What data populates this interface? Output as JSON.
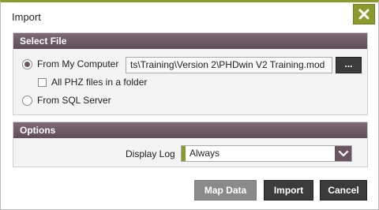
{
  "dialog": {
    "title": "Import",
    "close_icon": "close-icon"
  },
  "select_file": {
    "header": "Select File",
    "from_my_computer_label": "From My Computer",
    "from_my_computer_checked": true,
    "file_path_value": "ts\\Training\\Version 2\\PHDwin V2 Training.mod",
    "browse_label": "...",
    "all_phz_label": "All PHZ files in a folder",
    "all_phz_checked": false,
    "from_sql_label": "From SQL Server",
    "from_sql_checked": false
  },
  "options": {
    "header": "Options",
    "display_log_label": "Display Log",
    "display_log_value": "Always"
  },
  "buttons": {
    "map_data": "Map Data",
    "import": "Import",
    "cancel": "Cancel"
  },
  "colors": {
    "accent": "#8a9a2c",
    "header": "#6a5560",
    "button_dark": "#3b3b3b",
    "button_disabled": "#8a8a8a"
  }
}
